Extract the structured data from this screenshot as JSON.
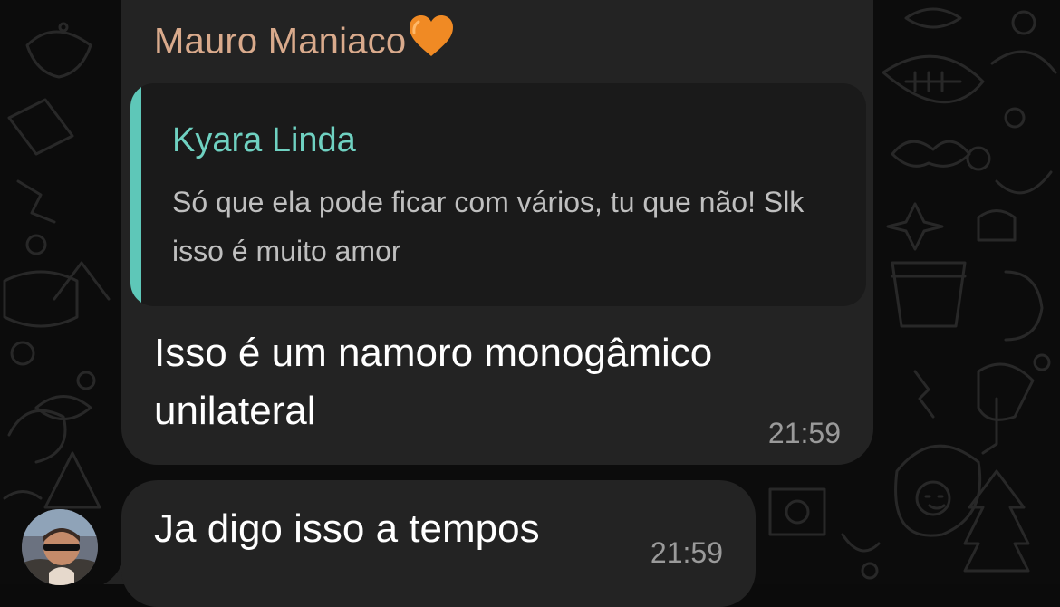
{
  "messages": [
    {
      "sender": "Mauro Maniaco",
      "sender_emoji": "orange-heart",
      "quote": {
        "author": "Kyara Linda",
        "text": "Só que ela pode ficar com vários, tu que não! Slk isso é muito amor"
      },
      "text": "Isso é um namoro monogâmico unilateral",
      "time": "21:59"
    },
    {
      "text": "Ja digo isso a tempos",
      "time": "21:59",
      "avatar": "user-avatar"
    }
  ],
  "colors": {
    "background": "#0c0c0c",
    "bubble": "#232323",
    "quote_bg": "#1a1a1a",
    "sender_name": "#d9aa8c",
    "quote_accent": "#5ec7b8",
    "quote_author": "#6fd1c1",
    "timestamp": "#9a9a9a"
  }
}
